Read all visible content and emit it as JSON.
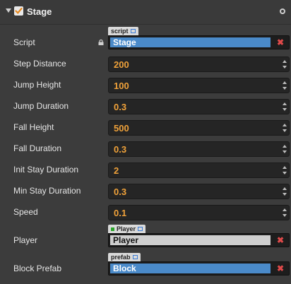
{
  "header": {
    "title": "Stage",
    "checked": true
  },
  "script": {
    "label": "Script",
    "tag": "script",
    "value": "Stage"
  },
  "numbers": [
    {
      "label": "Step Distance",
      "value": "200"
    },
    {
      "label": "Jump Height",
      "value": "100"
    },
    {
      "label": "Jump Duration",
      "value": "0.3"
    },
    {
      "label": "Fall Height",
      "value": "500"
    },
    {
      "label": "Fall Duration",
      "value": "0.3"
    },
    {
      "label": "Init Stay Duration",
      "value": "2"
    },
    {
      "label": "Min Stay Duration",
      "value": "0.3"
    },
    {
      "label": "Speed",
      "value": "0.1"
    }
  ],
  "player": {
    "label": "Player",
    "tag": "Player",
    "value": "Player"
  },
  "block_prefab": {
    "label": "Block Prefab",
    "tag": "prefab",
    "value": "Block"
  },
  "colors": {
    "accent_blue": "#4a8ac9",
    "number_orange": "#f0a23a",
    "clear_red": "#e04a4a"
  },
  "icons": {
    "fold": "triangle-down-icon",
    "check": "check-icon",
    "settings": "gear-icon",
    "lock": "lock-icon",
    "link": "external-link-icon",
    "clear": "close-icon"
  }
}
